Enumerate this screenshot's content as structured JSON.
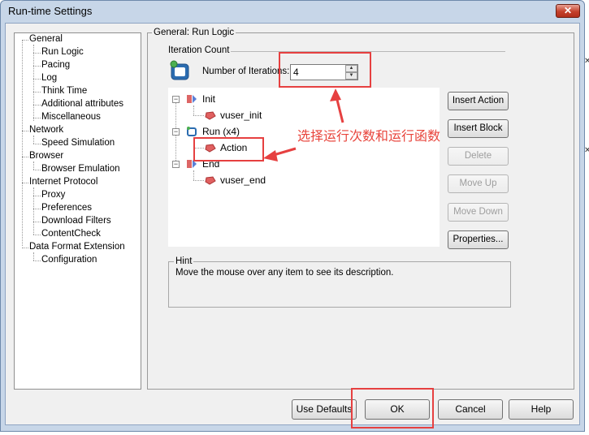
{
  "window": {
    "title": "Run-time Settings",
    "close_glyph": "✕"
  },
  "nav_tree": [
    {
      "label": "General",
      "level": 0
    },
    {
      "label": "Run Logic",
      "level": 1
    },
    {
      "label": "Pacing",
      "level": 1
    },
    {
      "label": "Log",
      "level": 1
    },
    {
      "label": "Think Time",
      "level": 1
    },
    {
      "label": "Additional attributes",
      "level": 1
    },
    {
      "label": "Miscellaneous",
      "level": 1
    },
    {
      "label": "Network",
      "level": 0
    },
    {
      "label": "Speed Simulation",
      "level": 1
    },
    {
      "label": "Browser",
      "level": 0
    },
    {
      "label": "Browser Emulation",
      "level": 1
    },
    {
      "label": "Internet Protocol",
      "level": 0
    },
    {
      "label": "Proxy",
      "level": 1
    },
    {
      "label": "Preferences",
      "level": 1
    },
    {
      "label": "Download Filters",
      "level": 1
    },
    {
      "label": "ContentCheck",
      "level": 1
    },
    {
      "label": "Data Format Extension",
      "level": 0
    },
    {
      "label": "Configuration",
      "level": 1
    }
  ],
  "panel": {
    "title": "General: Run Logic",
    "iteration_group": "Iteration Count",
    "iterations_label": "Number of Iterations:",
    "iterations_value": "4"
  },
  "logic_tree": {
    "init": "Init",
    "init_child": "vuser_init",
    "run": "Run (x4)",
    "run_child": "Action",
    "end": "End",
    "end_child": "vuser_end"
  },
  "side_buttons": {
    "insert_action": "Insert Action",
    "insert_block": "Insert Block",
    "delete": "Delete",
    "move_up": "Move Up",
    "move_down": "Move Down",
    "properties": "Properties..."
  },
  "hint": {
    "title": "Hint",
    "text": "Move the mouse over any item to see its description."
  },
  "annotation": {
    "text": "选择运行次数和运行函数",
    "color": "#e8453c"
  },
  "footer": {
    "use_defaults": "Use Defaults",
    "ok": "OK",
    "cancel": "Cancel",
    "help": "Help"
  },
  "colors": {
    "title_bar": "#c7d6e8",
    "close_button": "#c4402b",
    "annotation_red": "#e64040"
  }
}
